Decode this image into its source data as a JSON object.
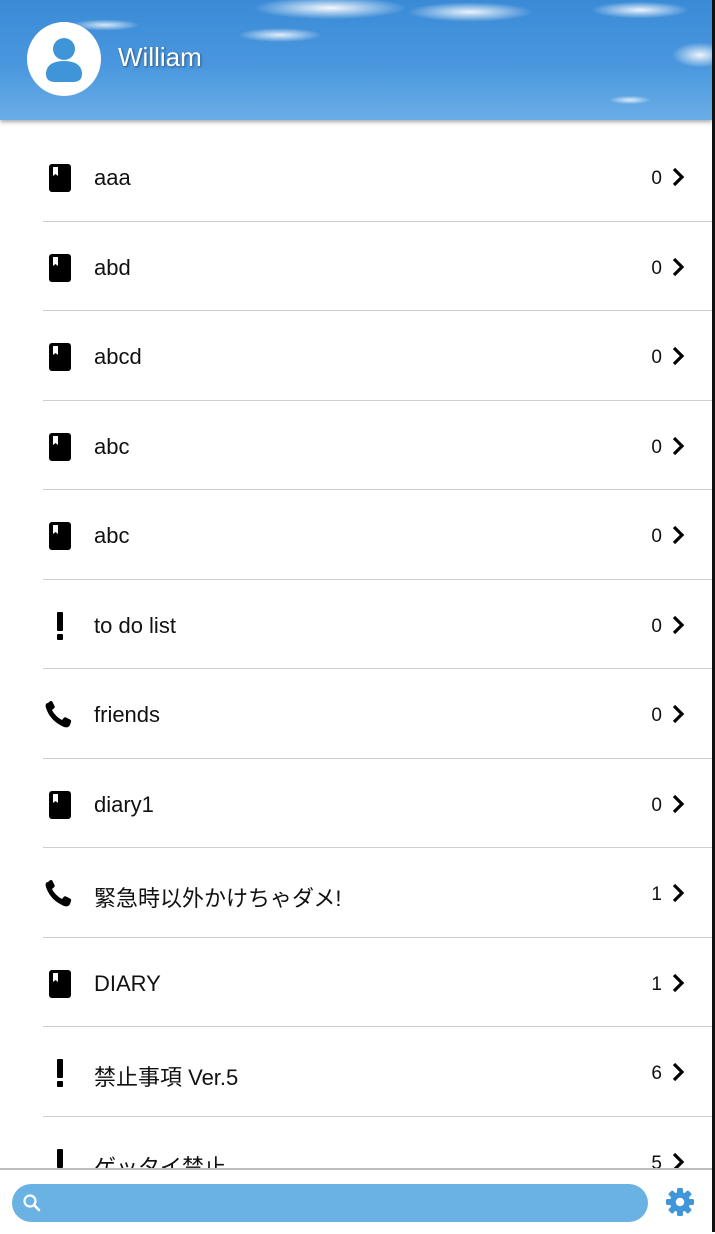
{
  "header": {
    "username": "William",
    "avatar_icon": "person-icon"
  },
  "notes": [
    {
      "label": "aaa",
      "count": "0",
      "icon": "book-icon"
    },
    {
      "label": "abd",
      "count": "0",
      "icon": "book-icon"
    },
    {
      "label": "abcd",
      "count": "0",
      "icon": "book-icon"
    },
    {
      "label": "abc",
      "count": "0",
      "icon": "book-icon"
    },
    {
      "label": "abc",
      "count": "0",
      "icon": "book-icon"
    },
    {
      "label": "to do list",
      "count": "0",
      "icon": "exclamation-icon"
    },
    {
      "label": "friends",
      "count": "0",
      "icon": "phone-icon"
    },
    {
      "label": "diary1",
      "count": "0",
      "icon": "book-icon"
    },
    {
      "label": "緊急時以外かけちゃダメ!",
      "count": "1",
      "icon": "phone-icon"
    },
    {
      "label": "DIARY",
      "count": "1",
      "icon": "book-icon"
    },
    {
      "label": "禁止事項 Ver.5",
      "count": "6",
      "icon": "exclamation-icon"
    },
    {
      "label": "ゲッタイ禁止",
      "count": "5",
      "icon": "exclamation-icon"
    }
  ],
  "bottom_bar": {
    "search_placeholder": "",
    "search_icon": "search-icon",
    "settings_icon": "gear-icon"
  },
  "colors": {
    "search_bar": "#6bb2e4",
    "gear": "#3f97d9",
    "header_sky": "#4a97de"
  }
}
